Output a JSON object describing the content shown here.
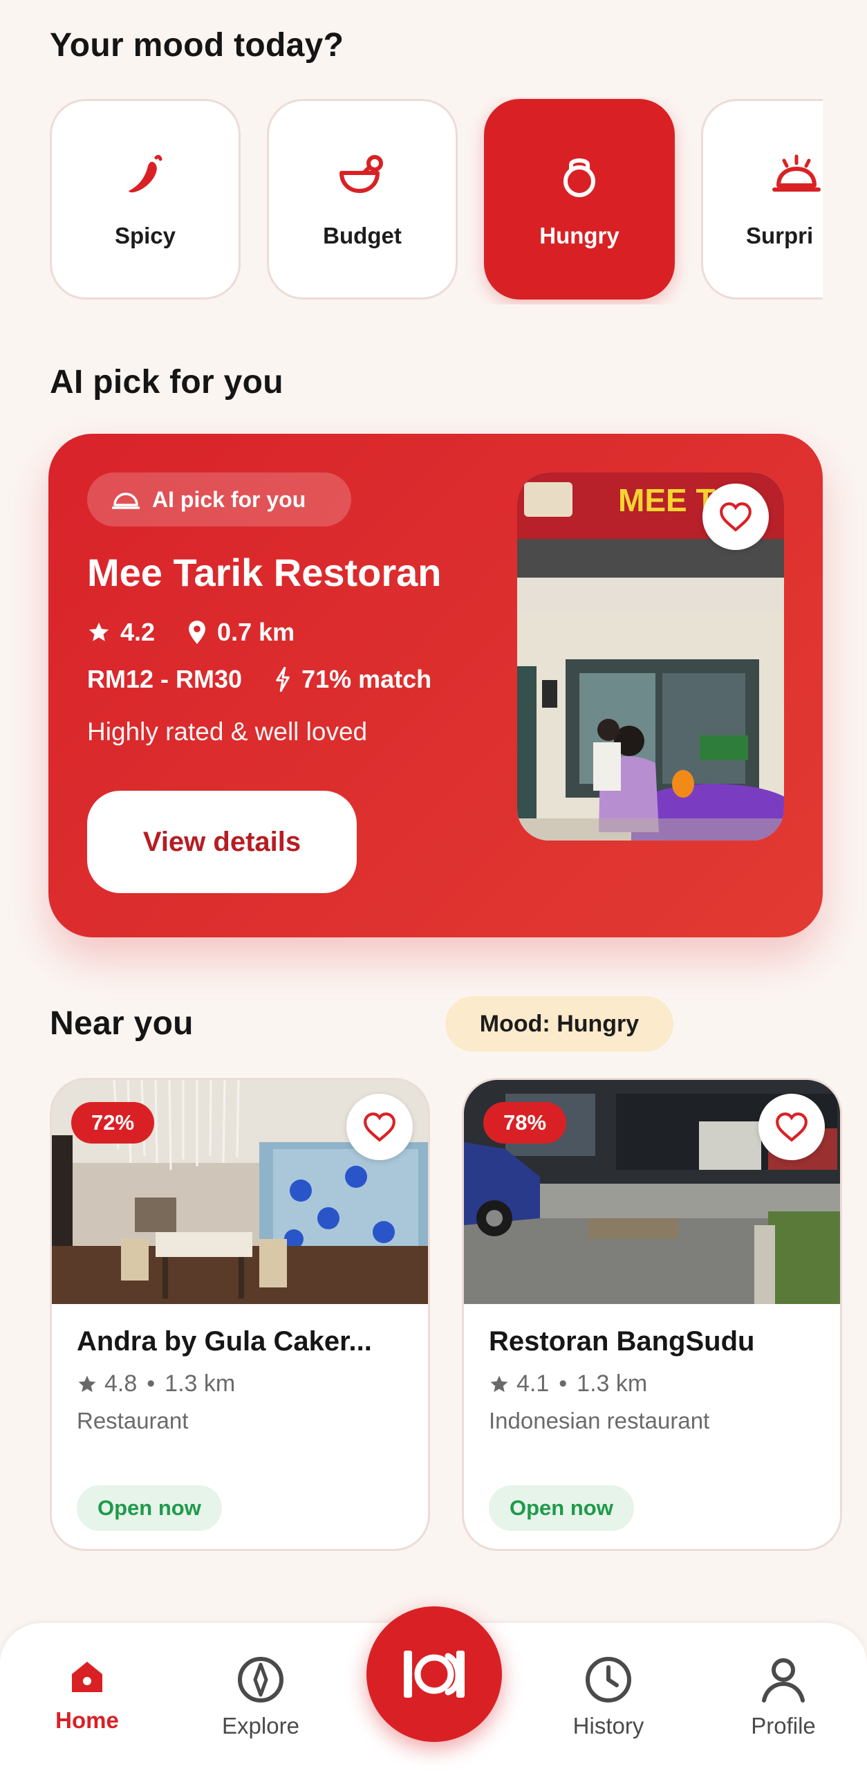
{
  "colors": {
    "accent": "#d92125",
    "background": "#fbf5f2",
    "open_green": "#1f9a4a",
    "mood_chip_bg": "#fbeacb"
  },
  "mood_section": {
    "title": "Your mood today?",
    "moods": [
      {
        "label": "Spicy",
        "icon": "chili-icon",
        "active": false
      },
      {
        "label": "Budget",
        "icon": "bowl-icon",
        "active": false
      },
      {
        "label": "Hungry",
        "icon": "lock-icon",
        "active": true
      },
      {
        "label": "Surpri",
        "icon": "cloche-icon",
        "active": false
      }
    ]
  },
  "ai_section": {
    "title": "AI pick for you",
    "badge": "AI pick for you",
    "name": "Mee Tarik Restoran",
    "rating": "4.2",
    "distance": "0.7 km",
    "price": "RM12 - RM30",
    "match": "71% match",
    "description": "Highly rated & well loved",
    "button": "View details",
    "photo_sign_text": "MEE T..."
  },
  "near_section": {
    "title": "Near you",
    "mood_chip": "Mood: Hungry",
    "places": [
      {
        "match": "72%",
        "name": "Andra by Gula Caker...",
        "rating": "4.8",
        "distance": "1.3 km",
        "type": "Restaurant",
        "status": "Open now"
      },
      {
        "match": "78%",
        "name": "Restoran BangSudu",
        "rating": "4.1",
        "distance": "1.3 km",
        "type": "Indonesian restaurant",
        "status": "Open now"
      }
    ]
  },
  "bottom_nav": {
    "items": [
      {
        "label": "Home",
        "icon": "home-icon",
        "active": true
      },
      {
        "label": "Explore",
        "icon": "compass-icon",
        "active": false
      },
      {
        "label": "History",
        "icon": "clock-icon",
        "active": false
      },
      {
        "label": "Profile",
        "icon": "user-icon",
        "active": false
      }
    ],
    "fab_icon": "camera-scan-icon"
  }
}
